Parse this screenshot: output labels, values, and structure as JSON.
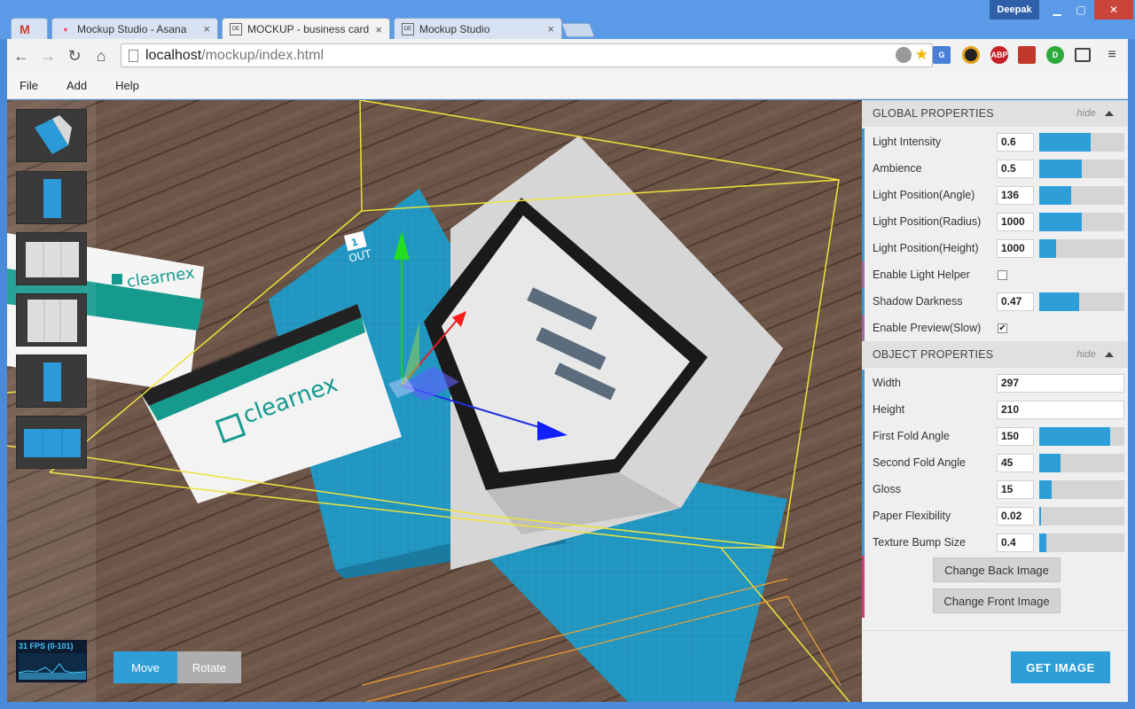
{
  "window": {
    "user": "Deepak",
    "tabs": [
      {
        "label": "Mockup Studio - Asana",
        "icon": "asana-icon"
      },
      {
        "label": "MOCKUP - business card -",
        "icon": "deep-icon"
      },
      {
        "label": "Mockup Studio",
        "icon": "deep-icon"
      }
    ],
    "gmail_icon": "gmail-icon",
    "close_glyph": "×"
  },
  "address": {
    "host": "localhost",
    "path": "/mockup/index.html"
  },
  "extensions": [
    "G",
    "",
    "ABP",
    "",
    "D"
  ],
  "menu": {
    "file": "File",
    "add": "Add",
    "help": "Help"
  },
  "viewport": {
    "fps_label": "31 FPS (0-101)",
    "move_label": "Move",
    "rotate_label": "Rotate",
    "card_brand": "clearnex",
    "cover_num": "1",
    "cover_text": "OUT"
  },
  "global": {
    "title": "GLOBAL PROPERTIES",
    "hide": "hide",
    "props": [
      {
        "label": "Light Intensity",
        "value": "0.6",
        "level": 0.6
      },
      {
        "label": "Ambience",
        "value": "0.5",
        "level": 0.5
      },
      {
        "label": "Light Position(Angle)",
        "value": "136",
        "level": 0.38
      },
      {
        "label": "Light Position(Radius)",
        "value": "1000",
        "level": 0.5
      },
      {
        "label": "Light Position(Height)",
        "value": "1000",
        "level": 0.2
      },
      {
        "label": "Enable Light Helper",
        "checked": false
      },
      {
        "label": "Shadow Darkness",
        "value": "0.47",
        "level": 0.47
      },
      {
        "label": "Enable Preview(Slow)",
        "checked": true
      }
    ]
  },
  "object": {
    "title": "OBJECT PROPERTIES",
    "hide": "hide",
    "props": [
      {
        "label": "Width",
        "value": "297"
      },
      {
        "label": "Height",
        "value": "210"
      },
      {
        "label": "First Fold Angle",
        "value": "150",
        "level": 0.83
      },
      {
        "label": "Second Fold Angle",
        "value": "45",
        "level": 0.25
      },
      {
        "label": "Gloss",
        "value": "15",
        "level": 0.15
      },
      {
        "label": "Paper Flexibility",
        "value": "0.02",
        "level": 0.02
      },
      {
        "label": "Texture Bump Size",
        "value": "0.4",
        "level": 0.08
      }
    ],
    "change_back": "Change Back Image",
    "change_front": "Change Front Image"
  },
  "get_image": "GET IMAGE"
}
